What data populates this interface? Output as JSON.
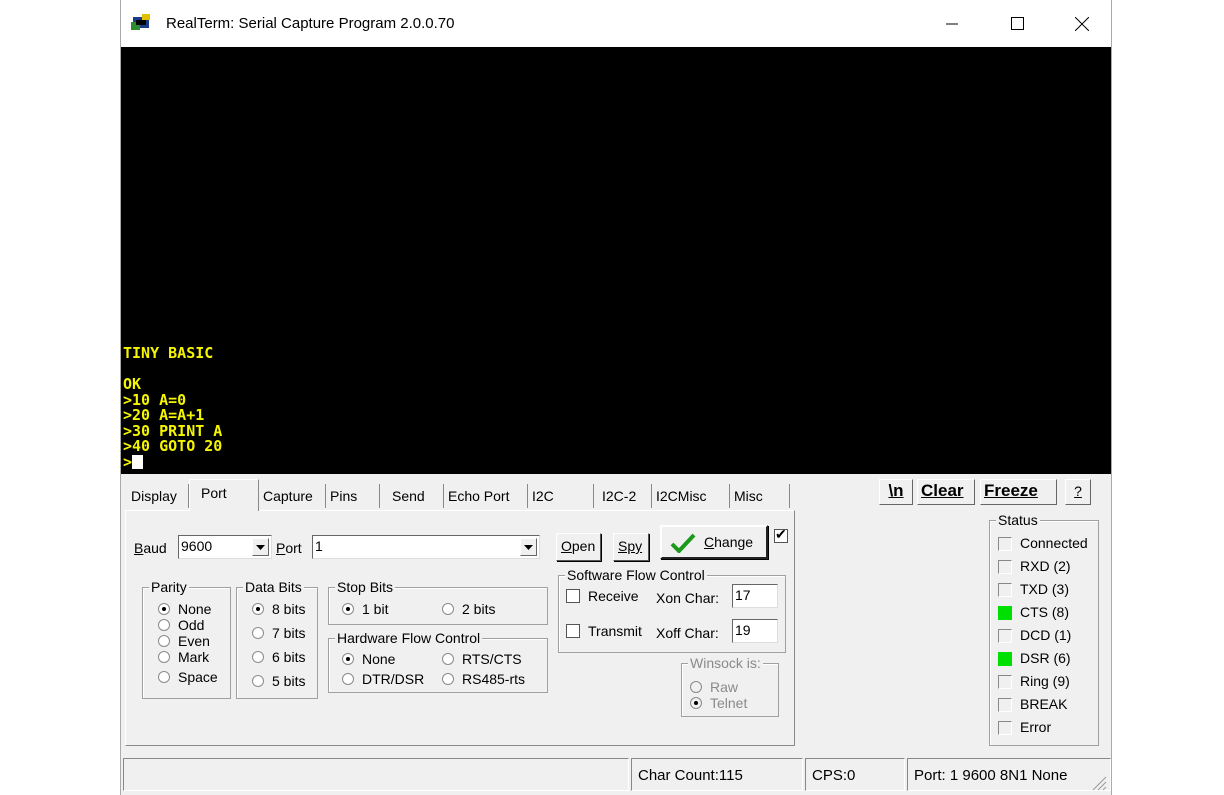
{
  "window": {
    "title": "RealTerm: Serial Capture Program 2.0.0.70"
  },
  "terminal": {
    "lines": [
      "TINY BASIC",
      "",
      "OK",
      ">10 A=0",
      ">20 A=A+1",
      ">30 PRINT A",
      ">40 GOTO 20"
    ],
    "prompt": ">",
    "text_color": "#f5f500",
    "background": "#000000"
  },
  "tabs": [
    "Display",
    "Port",
    "Capture",
    "Pins",
    "Send",
    "Echo Port",
    "I2C",
    "I2C-2",
    "I2CMisc",
    "Misc"
  ],
  "active_tab": "Port",
  "toolbar": {
    "newline_label": "\\n",
    "clear_label": "Clear",
    "freeze_label": "Freeze",
    "help_label": "?"
  },
  "port": {
    "baud_label": "Baud",
    "baud_value": "9600",
    "port_label": "Port",
    "port_value": "1",
    "open_label": "Open",
    "spy_label": "Spy",
    "change_label": "Change",
    "change_checkbox": true,
    "parity": {
      "title": "Parity",
      "options": [
        "None",
        "Odd",
        "Even",
        "Mark",
        "Space"
      ],
      "selected": "None"
    },
    "data_bits": {
      "title": "Data Bits",
      "options": [
        "8 bits",
        "7 bits",
        "6 bits",
        "5 bits"
      ],
      "selected": "8 bits"
    },
    "stop_bits": {
      "title": "Stop Bits",
      "options": [
        "1 bit",
        "2 bits"
      ],
      "selected": "1 bit"
    },
    "hw_flow": {
      "title": "Hardware Flow Control",
      "options": [
        "None",
        "RTS/CTS",
        "DTR/DSR",
        "RS485-rts"
      ],
      "selected": "None"
    },
    "sw_flow": {
      "title": "Software Flow Control",
      "receive_label": "Receive",
      "transmit_label": "Transmit",
      "receive_checked": false,
      "transmit_checked": false,
      "xon_label": "Xon Char:",
      "xon_value": "17",
      "xoff_label": "Xoff Char:",
      "xoff_value": "19"
    },
    "winsock": {
      "title": "Winsock is:",
      "options": [
        "Raw",
        "Telnet"
      ],
      "selected": "Telnet"
    }
  },
  "status": {
    "title": "Status",
    "items": [
      {
        "label": "Connected",
        "on": false
      },
      {
        "label": "RXD (2)",
        "on": false
      },
      {
        "label": "TXD (3)",
        "on": false
      },
      {
        "label": "CTS (8)",
        "on": true
      },
      {
        "label": "DCD (1)",
        "on": false
      },
      {
        "label": "DSR (6)",
        "on": true
      },
      {
        "label": "Ring (9)",
        "on": false
      },
      {
        "label": "BREAK",
        "on": false
      },
      {
        "label": "Error",
        "on": false
      }
    ],
    "led_on_color": "#00e000"
  },
  "statusbar": {
    "char_count": "Char Count:115",
    "cps": "CPS:0",
    "port_info": "Port: 1 9600 8N1 None"
  }
}
